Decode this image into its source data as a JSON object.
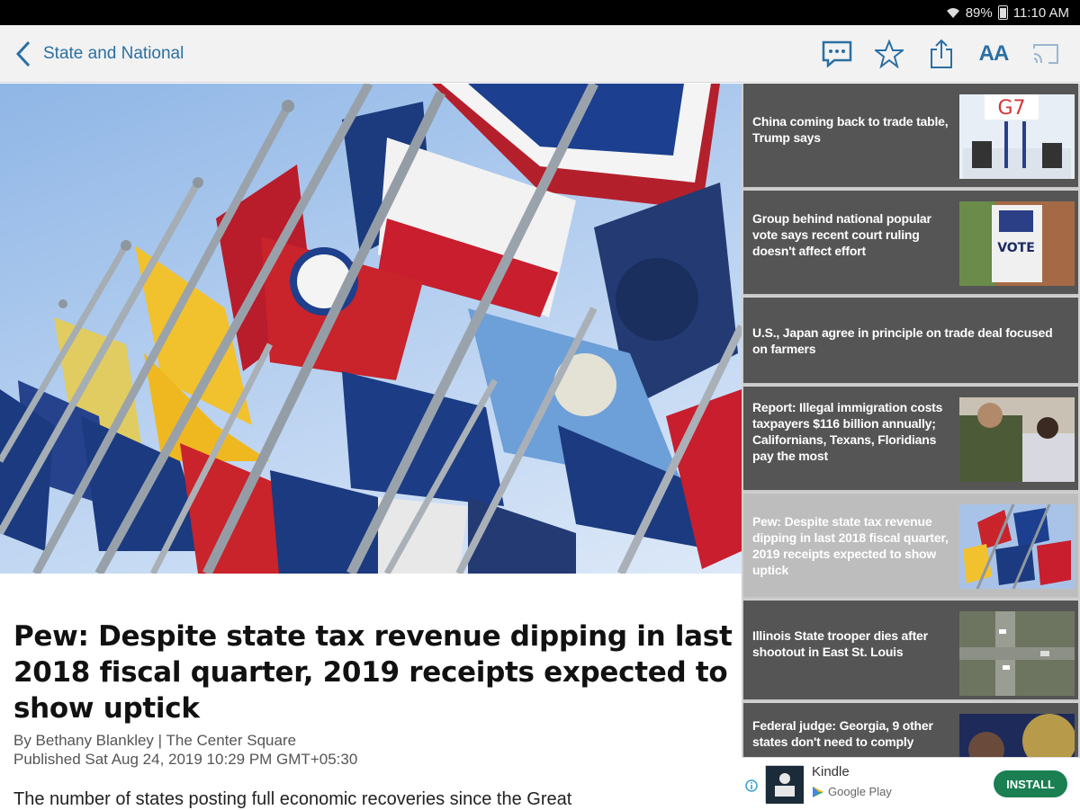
{
  "status_bar": {
    "battery": "89%",
    "time": "11:10 AM"
  },
  "app_bar": {
    "title": "State and National",
    "actions": [
      "comment-icon",
      "star-icon",
      "share-icon",
      "font-size-icon",
      "cast-icon"
    ],
    "font_size_label": "AA"
  },
  "article": {
    "headline": "Pew: Despite state tax revenue dipping in last 2018 fiscal quarter, 2019 receipts expected to show uptick",
    "byline": "By Bethany Blankley | The Center Square",
    "published": "Published Sat Aug 24, 2019 10:29 PM GMT+05:30",
    "body_start": "The number of states posting full economic recoveries since the Great"
  },
  "sidebar": {
    "items": [
      {
        "title": "China coming back to trade table, Trump says",
        "has_thumb": true,
        "active": false
      },
      {
        "title": "Group behind national popular vote says recent court ruling doesn't affect effort",
        "has_thumb": true,
        "active": false
      },
      {
        "title": "U.S., Japan agree in principle on trade deal focused on farmers",
        "has_thumb": false,
        "active": false
      },
      {
        "title": "Report: Illegal immigration costs taxpayers $116 billion annually; Californians, Texans, Floridians pay the most",
        "has_thumb": true,
        "active": false
      },
      {
        "title": "Pew: Despite state tax revenue dipping in last 2018 fiscal quarter, 2019 receipts expected to show uptick",
        "has_thumb": true,
        "active": true
      },
      {
        "title": "Illinois State trooper dies after shootout in East St. Louis",
        "has_thumb": true,
        "active": false
      },
      {
        "title": "Federal judge: Georgia, 9 other states don't need to comply",
        "has_thumb": true,
        "active": false
      }
    ]
  },
  "ad": {
    "app_name": "Kindle",
    "store": "Google Play",
    "install_label": "INSTALL"
  },
  "colors": {
    "accent": "#2b6fa3",
    "sidebar_item": "#555555",
    "sidebar_active": "#bdbdbd",
    "install_button": "#1a7f52"
  }
}
